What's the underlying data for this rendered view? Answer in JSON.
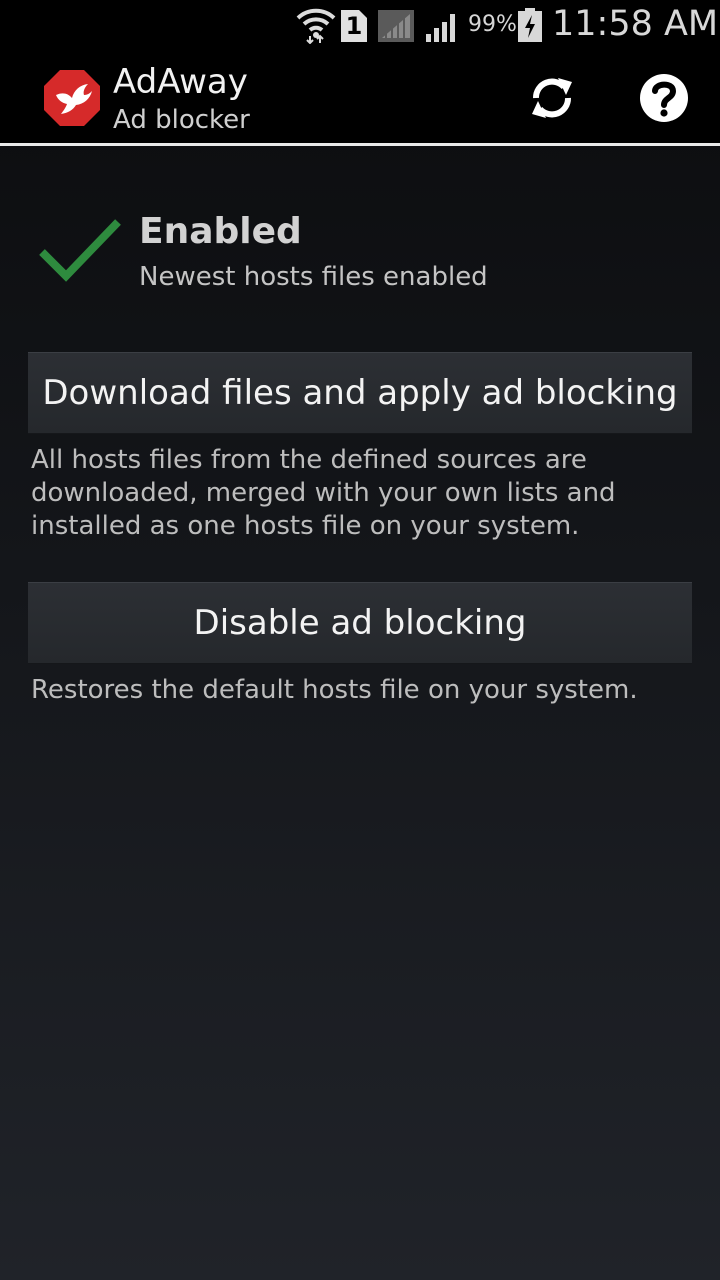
{
  "status_bar": {
    "sim_slot": "1",
    "battery_percent": "99%",
    "time": "11:58 AM",
    "icons": [
      "wifi-icon",
      "sim-icon",
      "signal-empty-icon",
      "signal-icon",
      "battery-charging-icon"
    ]
  },
  "action_bar": {
    "title": "AdAway",
    "subtitle": "Ad blocker",
    "logo": "adaway-logo",
    "actions": [
      "refresh-icon",
      "help-icon"
    ]
  },
  "status": {
    "title": "Enabled",
    "subtitle": "Newest hosts files enabled",
    "icon": "checkmark-icon",
    "icon_color": "#2e8b3e"
  },
  "buttons": {
    "download": {
      "label": "Download files and apply ad blocking",
      "description": "All hosts files from the defined sources are downloaded, merged with your own lists and installed as one hosts file on your system."
    },
    "disable": {
      "label": "Disable ad blocking",
      "description": "Restores the default hosts file on your system."
    }
  },
  "colors": {
    "logo_red": "#d62a2a",
    "background_top": "#0b0c0e",
    "background_bottom": "#202329",
    "text_primary": "#f3f3f3",
    "text_secondary": "#bdbdbd"
  }
}
